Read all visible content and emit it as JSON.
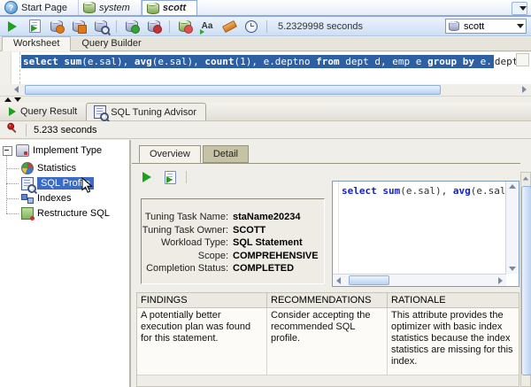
{
  "doc_tab_bar": {
    "start_page": "Start Page",
    "system": "system",
    "scott": "scott"
  },
  "main_toolbar": {
    "elapsed": "5.2329998 seconds",
    "connection": "scott"
  },
  "worksheet_tab_bar": {
    "worksheet": "Worksheet",
    "query_builder": "Query Builder"
  },
  "editor": {
    "sql_selected": [
      {
        "t": "select "
      },
      {
        "t": "sum"
      },
      {
        "t": "(e.sal), "
      },
      {
        "t": "avg"
      },
      {
        "t": "(e.sal), "
      },
      {
        "t": "count"
      },
      {
        "t": "(1), e.deptno "
      },
      {
        "t": "from"
      },
      {
        "t": " dept d, emp e "
      },
      {
        "t": "group by"
      },
      {
        "t": " e."
      }
    ],
    "sql_tail": "deptno"
  },
  "result_tab_bar": {
    "query_result": "Query Result",
    "sql_tuning_advisor": "SQL Tuning Advisor"
  },
  "advisor_bar": {
    "elapsed": "5.233 seconds"
  },
  "tree": {
    "root": "Implement Type",
    "items": [
      {
        "label": "Statistics"
      },
      {
        "label": "SQL Profile"
      },
      {
        "label": "Indexes"
      },
      {
        "label": "Restructure SQL"
      }
    ]
  },
  "overview": {
    "tab_overview": "Overview",
    "tab_detail": "Detail",
    "info_rows": [
      {
        "label": "Tuning Task Name:",
        "value": "staName20234"
      },
      {
        "label": "Tuning Task Owner:",
        "value": "SCOTT"
      },
      {
        "label": "Workload Type:",
        "value": "SQL Statement"
      },
      {
        "label": "Scope:",
        "value": "COMPREHENSIVE"
      },
      {
        "label": "Completion Status:",
        "value": "COMPLETED"
      }
    ],
    "sql_preview": [
      {
        "t": "select "
      },
      {
        "t": "sum"
      },
      {
        "t": "(e.sal), "
      },
      {
        "t": "avg"
      },
      {
        "t": "(e.sal"
      }
    ],
    "table": {
      "headers": [
        "FINDINGS",
        "RECOMMENDATIONS",
        "RATIONALE"
      ],
      "rows": [
        [
          "A potentially better execution plan was found for this statement.",
          "Consider accepting the recommended SQL profile.",
          "This attribute provides the optimizer with basic index statistics because the index statistics are missing for this index."
        ]
      ]
    }
  },
  "icons": {
    "help_glyph": "?",
    "case_glyph": "Aa"
  },
  "colors": {
    "selection_blue": "#2E5FA3",
    "tree_selection_blue": "#3A6BC5",
    "keyword_blue": "#1622C8",
    "detail_tab_khaki": "#C6C2A5"
  }
}
